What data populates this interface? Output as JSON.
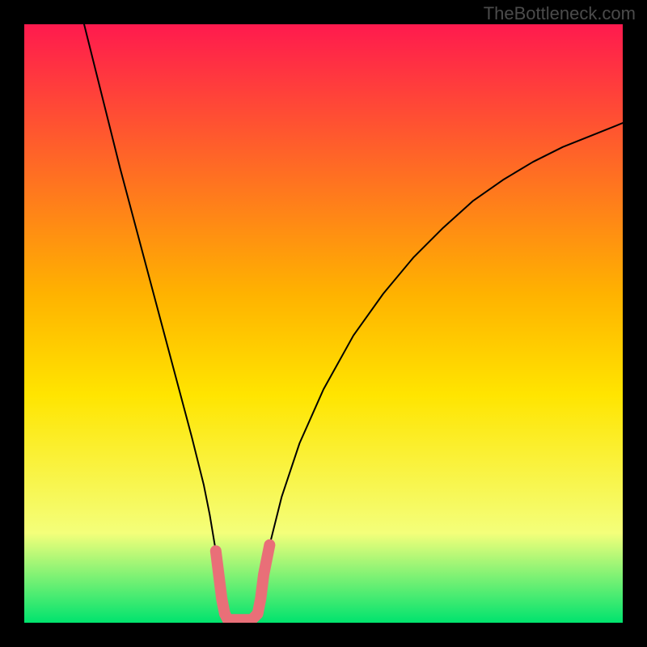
{
  "watermark": {
    "text": "TheBottleneck.com"
  },
  "chart_data": {
    "type": "line",
    "title": "",
    "xlabel": "",
    "ylabel": "",
    "xlim": [
      0,
      100
    ],
    "ylim": [
      0,
      100
    ],
    "grid": false,
    "legend": false,
    "gradient_colors": {
      "top": "#ff1a4e",
      "mid_upper": "#ffb200",
      "mid": "#ffe500",
      "lower": "#f4ff7a",
      "bottom": "#00e36e"
    },
    "series": [
      {
        "name": "bottleneck-curve",
        "stroke": "#000000",
        "points": [
          {
            "x": 10.0,
            "y": 100.0
          },
          {
            "x": 12.0,
            "y": 92.0
          },
          {
            "x": 14.0,
            "y": 84.0
          },
          {
            "x": 16.0,
            "y": 76.0
          },
          {
            "x": 18.0,
            "y": 68.5
          },
          {
            "x": 20.0,
            "y": 61.0
          },
          {
            "x": 22.0,
            "y": 53.5
          },
          {
            "x": 24.0,
            "y": 46.0
          },
          {
            "x": 26.0,
            "y": 38.5
          },
          {
            "x": 28.0,
            "y": 31.0
          },
          {
            "x": 30.0,
            "y": 23.0
          },
          {
            "x": 31.0,
            "y": 18.0
          },
          {
            "x": 32.0,
            "y": 12.0
          },
          {
            "x": 32.5,
            "y": 8.0
          },
          {
            "x": 33.0,
            "y": 4.0
          },
          {
            "x": 33.5,
            "y": 1.5
          },
          {
            "x": 34.0,
            "y": 0.5
          },
          {
            "x": 36.0,
            "y": 0.5
          },
          {
            "x": 38.0,
            "y": 0.5
          },
          {
            "x": 39.0,
            "y": 1.5
          },
          {
            "x": 39.5,
            "y": 4.0
          },
          {
            "x": 40.0,
            "y": 8.0
          },
          {
            "x": 41.0,
            "y": 13.0
          },
          {
            "x": 43.0,
            "y": 21.0
          },
          {
            "x": 46.0,
            "y": 30.0
          },
          {
            "x": 50.0,
            "y": 39.0
          },
          {
            "x": 55.0,
            "y": 48.0
          },
          {
            "x": 60.0,
            "y": 55.0
          },
          {
            "x": 65.0,
            "y": 61.0
          },
          {
            "x": 70.0,
            "y": 66.0
          },
          {
            "x": 75.0,
            "y": 70.5
          },
          {
            "x": 80.0,
            "y": 74.0
          },
          {
            "x": 85.0,
            "y": 77.0
          },
          {
            "x": 90.0,
            "y": 79.5
          },
          {
            "x": 95.0,
            "y": 81.5
          },
          {
            "x": 100.0,
            "y": 83.5
          }
        ]
      },
      {
        "name": "highlight-segment",
        "stroke": "#e96f78",
        "points": [
          {
            "x": 32.0,
            "y": 12.0
          },
          {
            "x": 32.5,
            "y": 8.0
          },
          {
            "x": 33.0,
            "y": 4.0
          },
          {
            "x": 33.5,
            "y": 1.5
          },
          {
            "x": 34.0,
            "y": 0.5
          },
          {
            "x": 36.0,
            "y": 0.5
          },
          {
            "x": 38.0,
            "y": 0.5
          },
          {
            "x": 39.0,
            "y": 1.5
          },
          {
            "x": 39.5,
            "y": 4.0
          },
          {
            "x": 40.0,
            "y": 8.0
          },
          {
            "x": 41.0,
            "y": 13.0
          }
        ]
      }
    ]
  }
}
